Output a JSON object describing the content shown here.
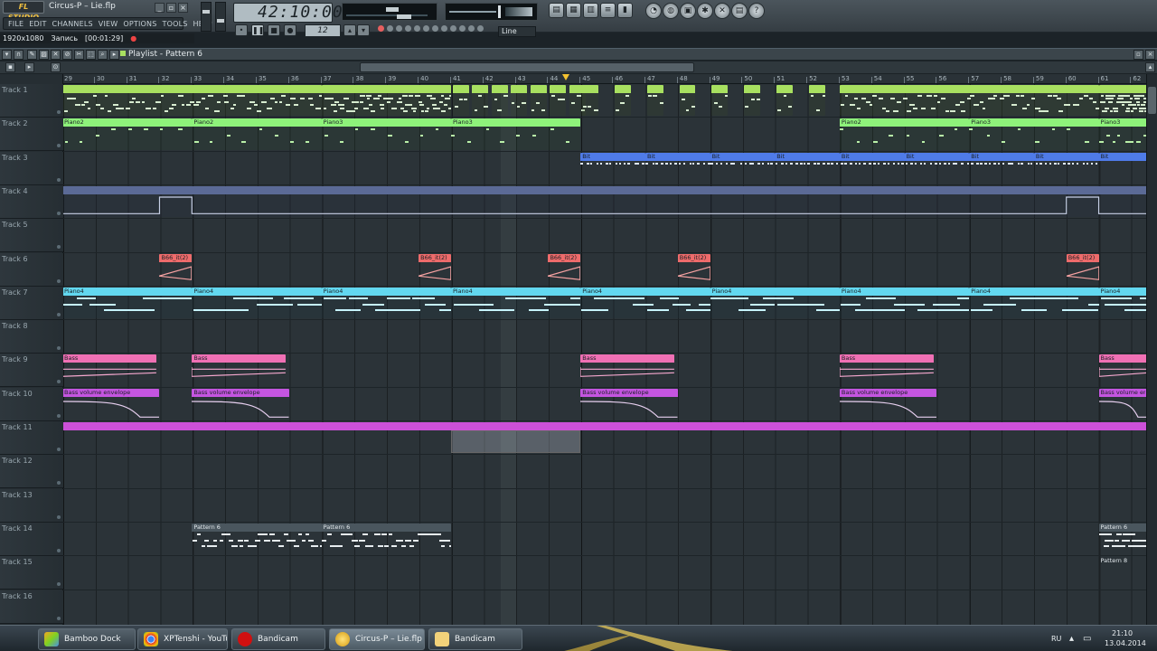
{
  "app": {
    "logo": "FL STUDIO",
    "project": "Circus-P – Lie.flp"
  },
  "menu": [
    "FILE",
    "EDIT",
    "CHANNELS",
    "VIEW",
    "OPTIONS",
    "TOOLS",
    "HELP"
  ],
  "transport": {
    "time": "42:10:001",
    "pattern_num": "12",
    "snap": "Line",
    "snap_small": "⁄⁄⁄"
  },
  "recording": {
    "resolution": "1920x1080",
    "label": "Запись",
    "time": "[00:01:29]"
  },
  "playlist": {
    "title": "Playlist - Pattern 6"
  },
  "ruler": [
    29,
    30,
    31,
    32,
    33,
    34,
    35,
    36,
    37,
    38,
    39,
    40,
    41,
    42,
    43,
    44,
    45,
    46,
    47,
    48,
    49,
    50,
    51,
    52,
    53,
    54,
    55,
    56,
    57,
    58,
    59,
    60,
    61,
    62
  ],
  "tracks": [
    "Track 1",
    "Track 2",
    "Track 3",
    "Track 4",
    "Track 5",
    "Track 6",
    "Track 7",
    "Track 8",
    "Track 9",
    "Track 10",
    "Track 11",
    "Track 12",
    "Track 13",
    "Track 14",
    "Track 15",
    "Track 16"
  ],
  "clips": {
    "piano2": "Piano2",
    "piano3": "Piano3",
    "bit": "Bit",
    "b66": "B66_it(2)",
    "piano4": "Piano4",
    "bass": "Bass",
    "bass_env": "Bass volume envelope",
    "pattern6": "Pattern 6",
    "pattern8": "Pattern 8",
    "pa": "Pa"
  },
  "colors": {
    "green": "#a8e060",
    "lightgreen": "#8ef27a",
    "blue": "#4f7be8",
    "slate": "#5b6a96",
    "red": "#ee6b6b",
    "cyan": "#62d8f0",
    "pink": "#f070b4",
    "magenta": "#c455e0",
    "purple_bar": "#cc50d8",
    "accent": "#f4c230"
  },
  "taskbar": {
    "items": [
      "Bamboo Dock",
      "XPTenshi - YouTu...",
      "Bandicam",
      "Circus-P – Lie.flp",
      "Bandicam"
    ],
    "lang": "RU",
    "time": "21:10",
    "date": "13.04.2014"
  }
}
